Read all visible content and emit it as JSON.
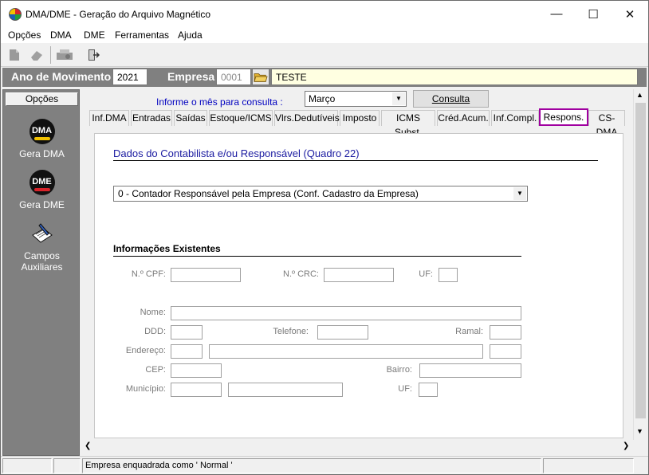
{
  "window": {
    "title": "DMA/DME - Geração do Arquivo Magnético"
  },
  "menu": [
    "Opções",
    "DMA",
    "DME",
    "Ferramentas",
    "Ajuda"
  ],
  "header": {
    "ano_label": "Ano de Movimento",
    "ano_value": "2021",
    "empresa_label": "Empresa",
    "empresa_code": "0001",
    "empresa_name": "TESTE"
  },
  "left_panel": {
    "tab": "Opções",
    "items": [
      {
        "label": "Gera DMA",
        "icon": "dma-icon",
        "icon_text": "DMA"
      },
      {
        "label": "Gera DME",
        "icon": "dme-icon",
        "icon_text": "DME"
      },
      {
        "label": "Campos Auxiliares",
        "icon": "notepad-pencil-icon"
      }
    ]
  },
  "consulta": {
    "label": "Informe o mês para consulta :",
    "month": "Março",
    "button": "Consulta"
  },
  "tabs": [
    "Inf.DMA",
    "Entradas",
    "Saídas",
    "Estoque/ICMS",
    "Vlrs.Dedutíveis",
    "Imposto",
    "ICMS Subst.",
    "Créd.Acum.",
    "Inf.Compl.",
    "Respons.",
    "CS-DMA"
  ],
  "active_tab": "Respons.",
  "form": {
    "section_title": "Dados do Contabilista e/ou Responsável (Quadro 22)",
    "responsavel_select": "0 - Contador Responsável pela Empresa (Conf. Cadastro da Empresa)",
    "info_title": "Informações Existentes",
    "labels": {
      "cpf": "N.º CPF:",
      "crc": "N.º CRC:",
      "uf": "UF:",
      "nome": "Nome:",
      "ddd": "DDD:",
      "telefone": "Telefone:",
      "ramal": "Ramal:",
      "endereco": "Endereço:",
      "cep": "CEP:",
      "bairro": "Bairro:",
      "municipio": "Município:",
      "uf2": "UF:"
    }
  },
  "status": {
    "text": "Empresa enquadrada como ' Normal '"
  }
}
